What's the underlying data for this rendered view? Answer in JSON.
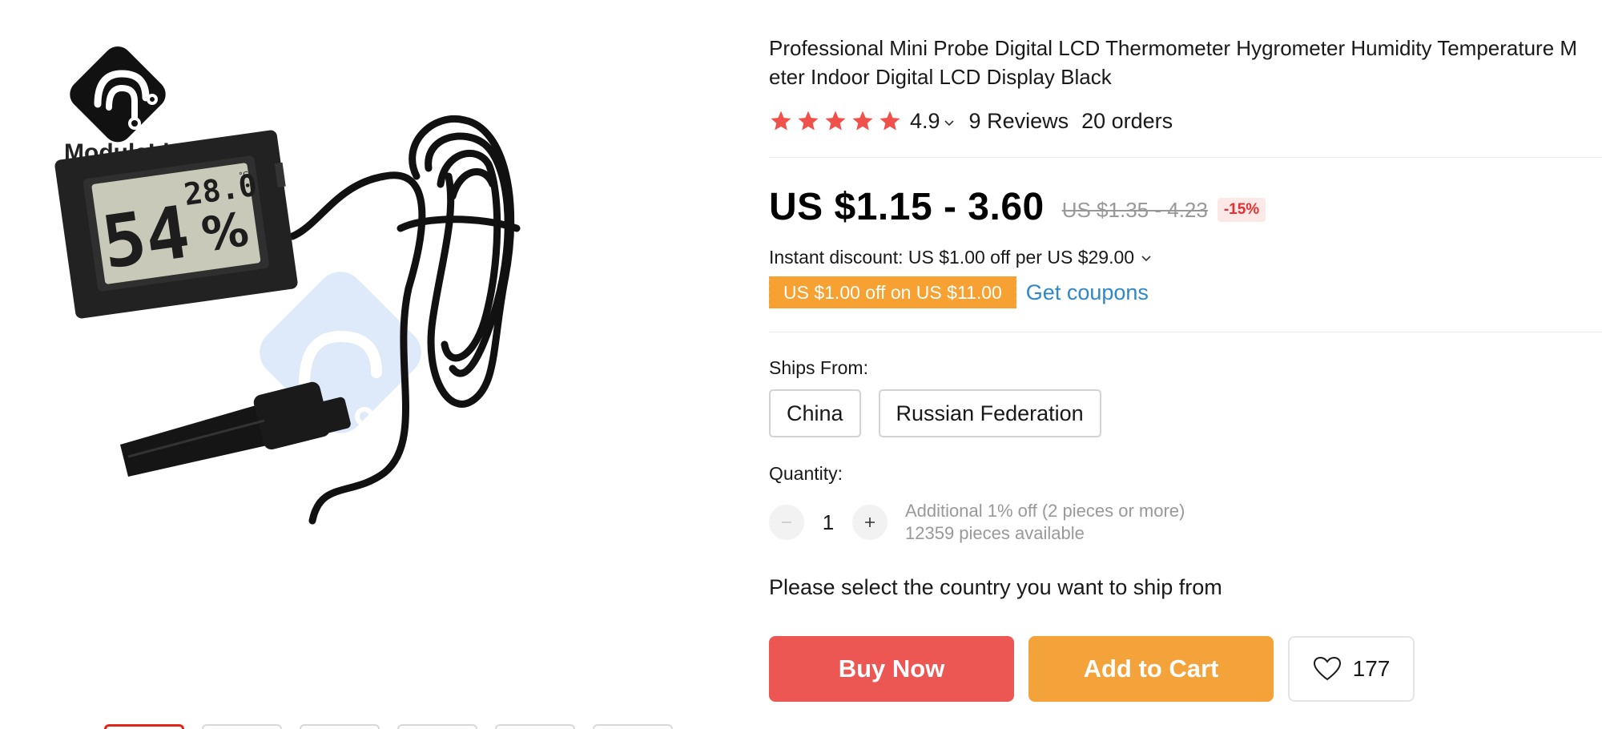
{
  "product": {
    "title": "Professional Mini Probe Digital LCD Thermometer Hygrometer Humidity Temperature Meter Indoor Digital LCD Display Black",
    "brand_logo_text": "ModuleLive",
    "lcd_reading_large": "54",
    "lcd_reading_temp": "28.0",
    "lcd_unit": "%",
    "lcd_temp_unit": "°C"
  },
  "rating": {
    "value": "4.9",
    "stars": 5,
    "reviews": "9 Reviews",
    "orders": "20 orders"
  },
  "price": {
    "current": "US $1.15 - 3.60",
    "original": "US $1.35 - 4.23",
    "discount": "-15%"
  },
  "promotions": {
    "instant_discount": "Instant discount: US $1.00 off per US $29.00",
    "coupon": "US $1.00 off on US $11.00",
    "get_coupons": "Get coupons"
  },
  "shipping": {
    "label": "Ships From:",
    "options": [
      "China",
      "Russian Federation"
    ]
  },
  "quantity": {
    "label": "Quantity:",
    "value": "1",
    "additional_off": "Additional 1% off (2 pieces or more)",
    "available": "12359 pieces available"
  },
  "ship_note": "Please select the country you want to ship from",
  "actions": {
    "buy_now": "Buy Now",
    "add_to_cart": "Add to Cart",
    "wishlist_count": "177"
  },
  "gallery": {
    "thumbnail_count": 6,
    "active_index": 0
  },
  "colors": {
    "star": "#f0514b",
    "buy_now": "#ec5653",
    "add_to_cart": "#f4a23a",
    "coupon": "#f6a131",
    "link": "#2e87c9",
    "discount_text": "#e62e2e"
  }
}
